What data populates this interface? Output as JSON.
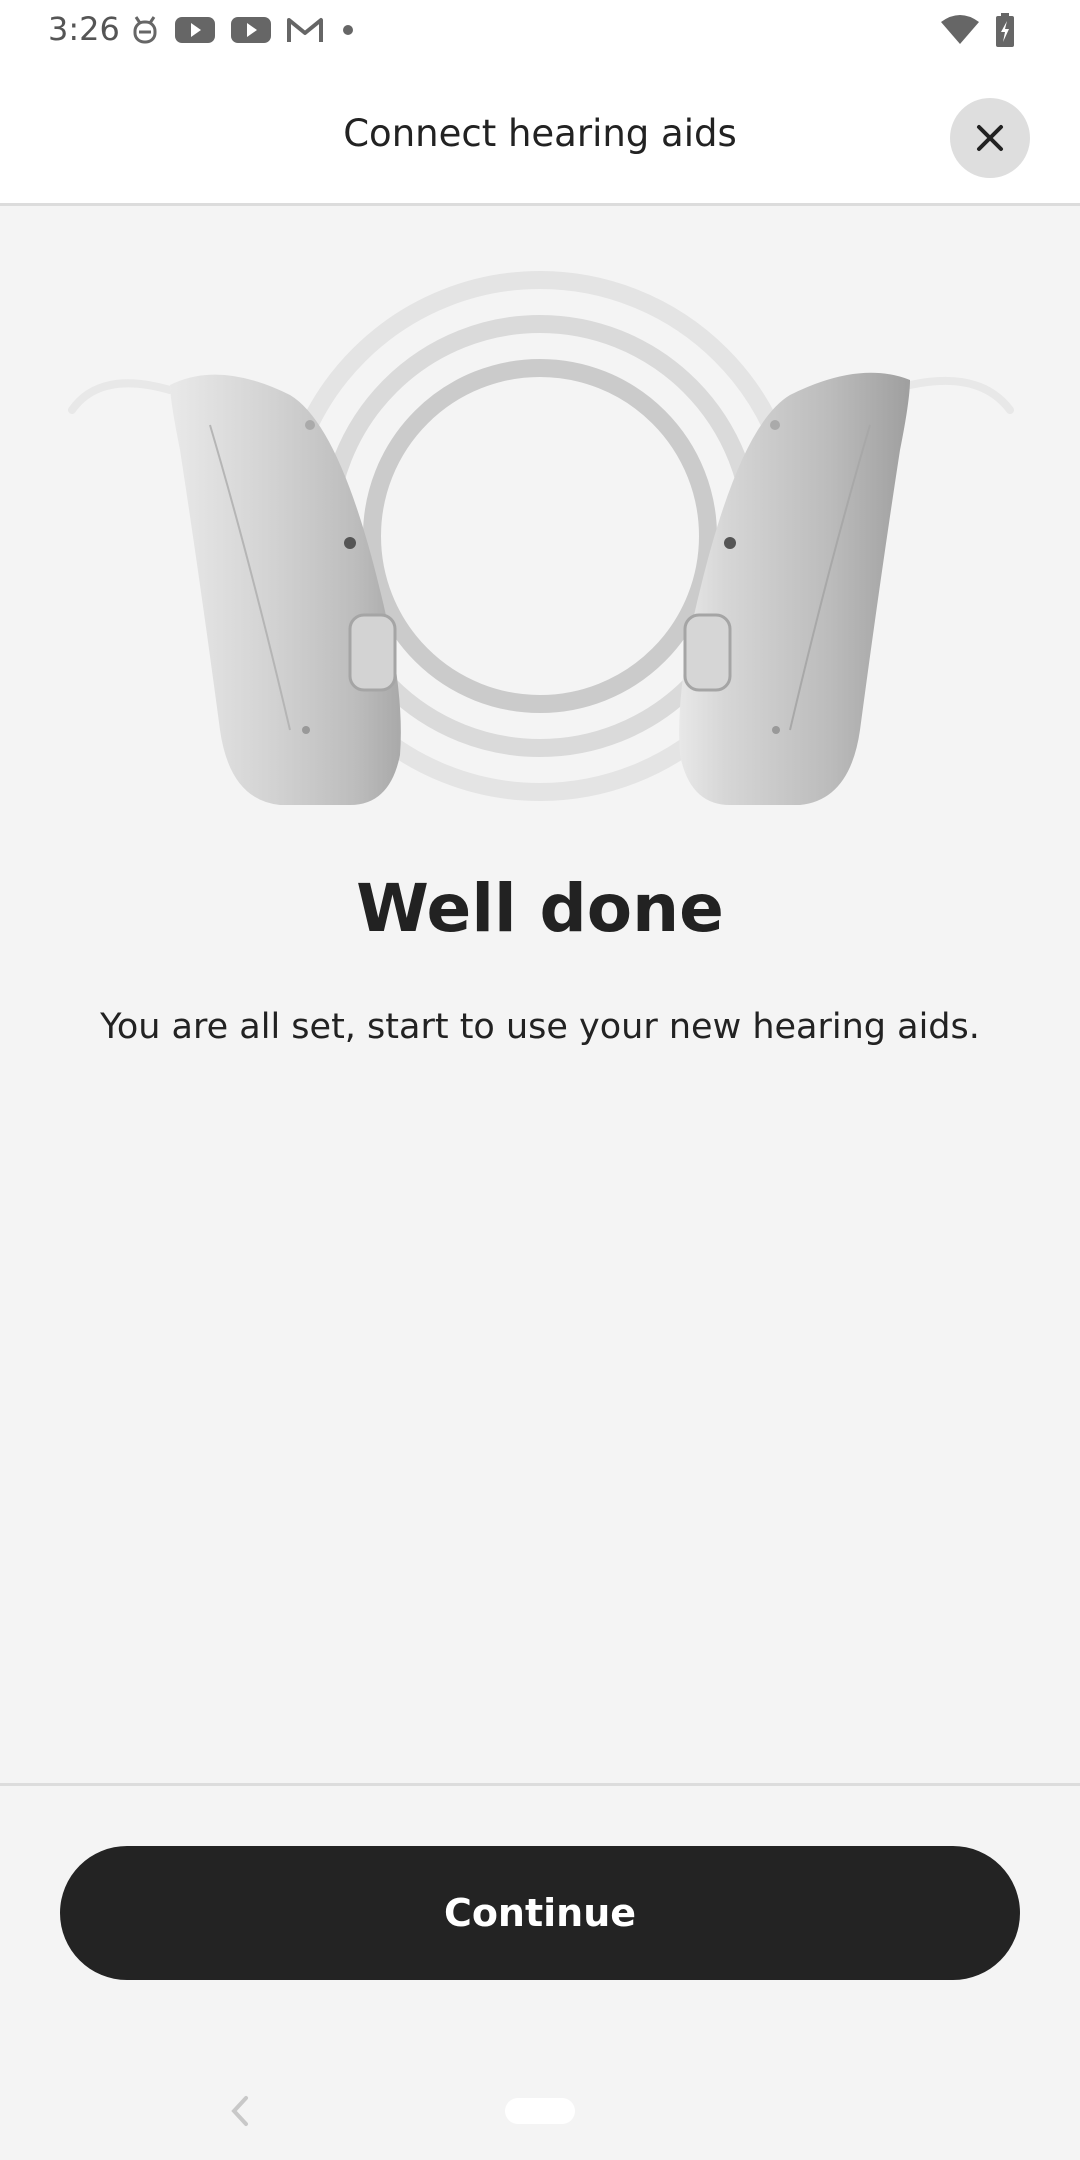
{
  "status_bar": {
    "time": "3:26",
    "left_icons": [
      "cat-notification-icon",
      "youtube-icon",
      "youtube-icon",
      "gmail-icon",
      "dot-icon"
    ],
    "right_icons": [
      "wifi-icon",
      "battery-charging-icon"
    ]
  },
  "header": {
    "title": "Connect hearing aids",
    "close_icon": "close-icon"
  },
  "hero": {
    "image": "hearing-aids-illustration"
  },
  "content": {
    "headline": "Well done",
    "body": "You are all set, start to use your new hearing aids."
  },
  "footer": {
    "continue_label": "Continue"
  },
  "colors": {
    "background": "#f4f4f4",
    "header_bg": "#ffffff",
    "primary_button": "#232323",
    "button_text": "#ffffff",
    "text": "#222222"
  }
}
